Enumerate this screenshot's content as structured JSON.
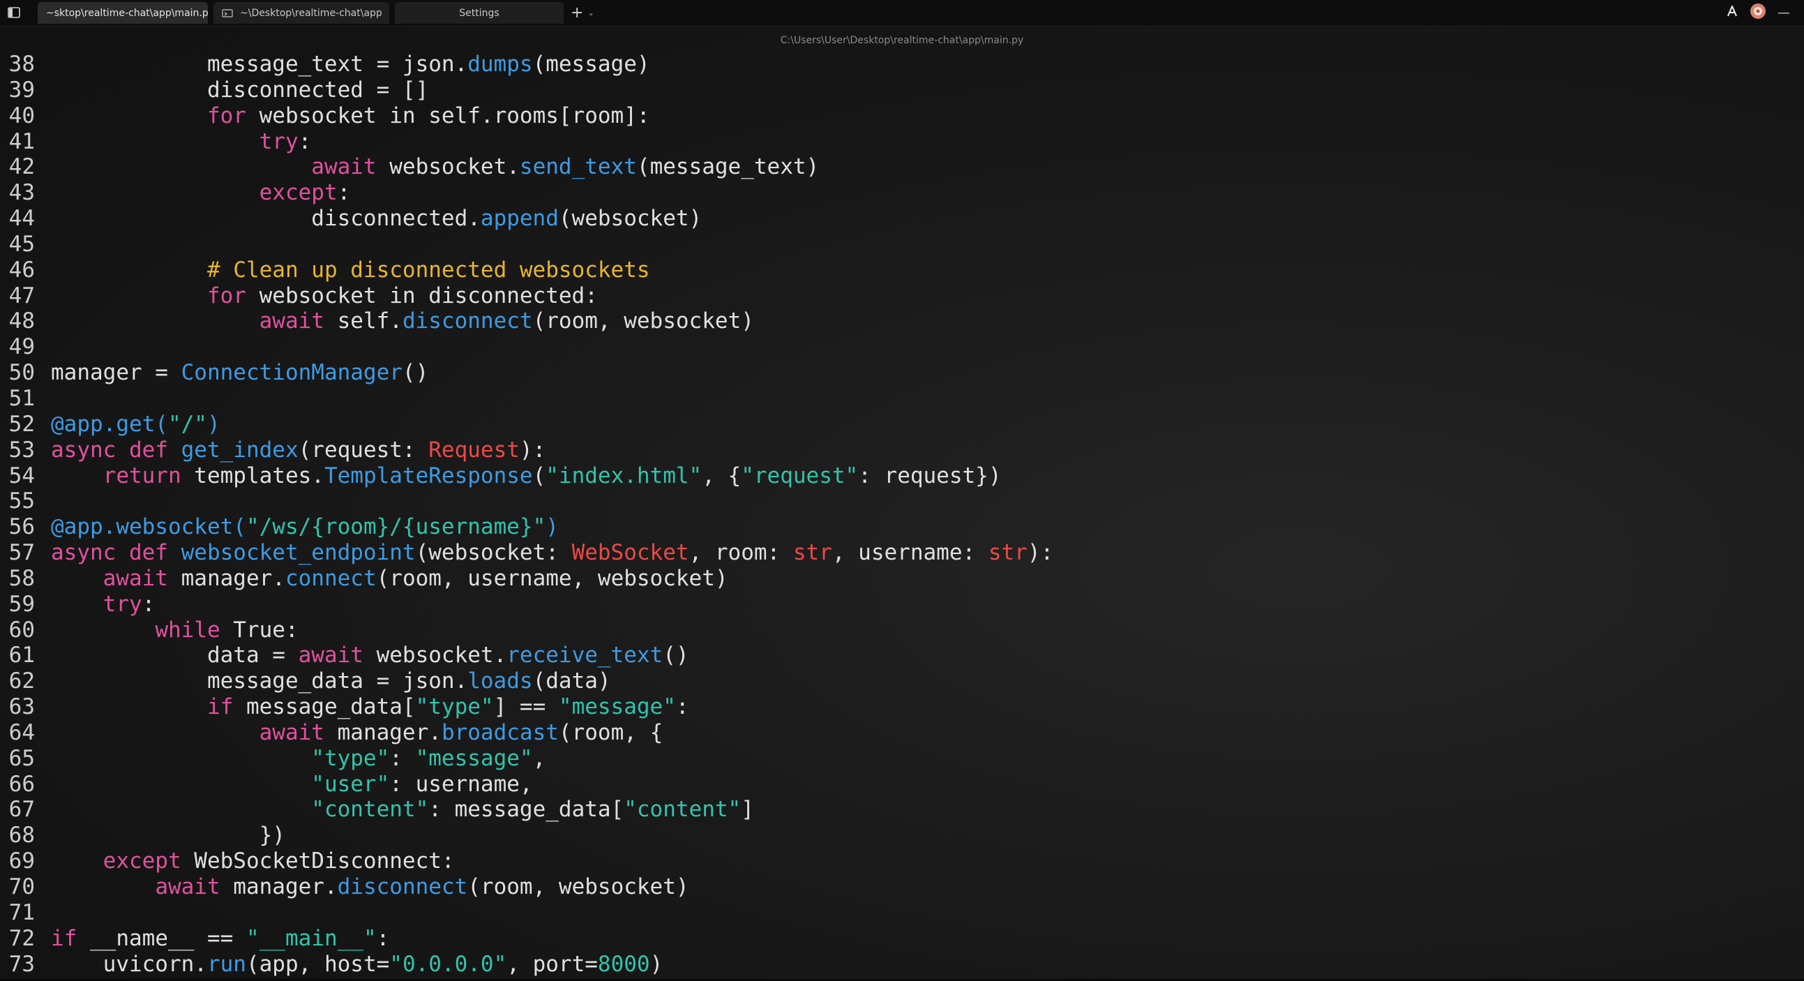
{
  "tabs": [
    {
      "label": "~sktop\\realtime-chat\\app\\main.py",
      "active": true
    },
    {
      "label": "~\\Desktop\\realtime-chat\\app",
      "active": false
    },
    {
      "label": "Settings",
      "active": false
    }
  ],
  "new_tab_symbol": "+",
  "dropdown_symbol": "⌄",
  "window_minimize_symbol": "—",
  "title_path": "C:\\Users\\User\\Desktop\\realtime-chat\\app\\main.py",
  "icons": {
    "sidebar": "sidebar-toggle-icon",
    "tab_folder": "folder-icon",
    "user_account": "account-icon",
    "profile_badge": "profile-badge-icon"
  },
  "syntax_colors": {
    "keyword": "#e0519e",
    "function": "#3e9be3",
    "string": "#33c3ac",
    "comment": "#e8b52f",
    "type": "#ea4a47",
    "plain": "#e0e0e0"
  },
  "editor": {
    "lines": [
      {
        "no": "38",
        "tokens": [
          [
            "p",
            "            message_text = json."
          ],
          [
            "fn",
            "dumps"
          ],
          [
            "p",
            "(message)"
          ]
        ]
      },
      {
        "no": "39",
        "tokens": [
          [
            "p",
            "            disconnected = []"
          ]
        ]
      },
      {
        "no": "40",
        "tokens": [
          [
            "p",
            "            "
          ],
          [
            "kw",
            "for"
          ],
          [
            "p",
            " websocket in self.rooms[room]:"
          ]
        ]
      },
      {
        "no": "41",
        "tokens": [
          [
            "p",
            "                "
          ],
          [
            "kw",
            "try"
          ],
          [
            "p",
            ":"
          ]
        ]
      },
      {
        "no": "42",
        "tokens": [
          [
            "p",
            "                    "
          ],
          [
            "kw",
            "await"
          ],
          [
            "p",
            " websocket."
          ],
          [
            "fn",
            "send_text"
          ],
          [
            "p",
            "(message_text)"
          ]
        ]
      },
      {
        "no": "43",
        "tokens": [
          [
            "p",
            "                "
          ],
          [
            "kw",
            "except"
          ],
          [
            "p",
            ":"
          ]
        ]
      },
      {
        "no": "44",
        "tokens": [
          [
            "p",
            "                    disconnected."
          ],
          [
            "fn",
            "append"
          ],
          [
            "p",
            "(websocket)"
          ]
        ]
      },
      {
        "no": "45",
        "tokens": [
          [
            "p",
            ""
          ]
        ]
      },
      {
        "no": "46",
        "tokens": [
          [
            "p",
            "            "
          ],
          [
            "cm",
            "# Clean up disconnected websockets"
          ]
        ]
      },
      {
        "no": "47",
        "tokens": [
          [
            "p",
            "            "
          ],
          [
            "kw",
            "for"
          ],
          [
            "p",
            " websocket in disconnected:"
          ]
        ]
      },
      {
        "no": "48",
        "tokens": [
          [
            "p",
            "                "
          ],
          [
            "kw",
            "await"
          ],
          [
            "p",
            " self."
          ],
          [
            "fn",
            "disconnect"
          ],
          [
            "p",
            "(room, websocket)"
          ]
        ]
      },
      {
        "no": "49",
        "tokens": [
          [
            "p",
            ""
          ]
        ]
      },
      {
        "no": "50",
        "tokens": [
          [
            "p",
            "manager = "
          ],
          [
            "fn",
            "ConnectionManager"
          ],
          [
            "p",
            "()"
          ]
        ]
      },
      {
        "no": "51",
        "tokens": [
          [
            "p",
            ""
          ]
        ]
      },
      {
        "no": "52",
        "tokens": [
          [
            "fn",
            "@app.get("
          ],
          [
            "str",
            "\"/\""
          ],
          [
            "fn",
            ")"
          ]
        ]
      },
      {
        "no": "53",
        "tokens": [
          [
            "kw",
            "async def "
          ],
          [
            "fn",
            "get_index"
          ],
          [
            "p",
            "(request: "
          ],
          [
            "ty",
            "Request"
          ],
          [
            "p",
            "):"
          ]
        ]
      },
      {
        "no": "54",
        "tokens": [
          [
            "p",
            "    "
          ],
          [
            "kw",
            "return"
          ],
          [
            "p",
            " templates."
          ],
          [
            "fn",
            "TemplateResponse"
          ],
          [
            "p",
            "("
          ],
          [
            "str",
            "\"index.html\""
          ],
          [
            "p",
            ", {"
          ],
          [
            "str",
            "\"request\""
          ],
          [
            "p",
            ": request})"
          ]
        ]
      },
      {
        "no": "55",
        "tokens": [
          [
            "p",
            ""
          ]
        ]
      },
      {
        "no": "56",
        "tokens": [
          [
            "fn",
            "@app.websocket("
          ],
          [
            "str",
            "\"/ws/{room}/{username}\""
          ],
          [
            "fn",
            ")"
          ]
        ]
      },
      {
        "no": "57",
        "tokens": [
          [
            "kw",
            "async def "
          ],
          [
            "fn",
            "websocket_endpoint"
          ],
          [
            "p",
            "(websocket: "
          ],
          [
            "ty",
            "WebSocket"
          ],
          [
            "p",
            ", room: "
          ],
          [
            "ty",
            "str"
          ],
          [
            "p",
            ", username: "
          ],
          [
            "ty",
            "str"
          ],
          [
            "p",
            "):"
          ]
        ]
      },
      {
        "no": "58",
        "tokens": [
          [
            "p",
            "    "
          ],
          [
            "kw",
            "await"
          ],
          [
            "p",
            " manager."
          ],
          [
            "fn",
            "connect"
          ],
          [
            "p",
            "(room, username, websocket)"
          ]
        ]
      },
      {
        "no": "59",
        "tokens": [
          [
            "p",
            "    "
          ],
          [
            "kw",
            "try"
          ],
          [
            "p",
            ":"
          ]
        ]
      },
      {
        "no": "60",
        "tokens": [
          [
            "p",
            "        "
          ],
          [
            "kw",
            "while"
          ],
          [
            "p",
            " True:"
          ]
        ]
      },
      {
        "no": "61",
        "tokens": [
          [
            "p",
            "            data = "
          ],
          [
            "kw",
            "await"
          ],
          [
            "p",
            " websocket."
          ],
          [
            "fn",
            "receive_text"
          ],
          [
            "p",
            "()"
          ]
        ]
      },
      {
        "no": "62",
        "tokens": [
          [
            "p",
            "            message_data = json."
          ],
          [
            "fn",
            "loads"
          ],
          [
            "p",
            "(data)"
          ]
        ]
      },
      {
        "no": "63",
        "tokens": [
          [
            "p",
            "            "
          ],
          [
            "kw",
            "if"
          ],
          [
            "p",
            " message_data["
          ],
          [
            "str",
            "\"type\""
          ],
          [
            "p",
            "] == "
          ],
          [
            "str",
            "\"message\""
          ],
          [
            "p",
            ":"
          ]
        ]
      },
      {
        "no": "64",
        "tokens": [
          [
            "p",
            "                "
          ],
          [
            "kw",
            "await"
          ],
          [
            "p",
            " manager."
          ],
          [
            "fn",
            "broadcast"
          ],
          [
            "p",
            "(room, {"
          ]
        ]
      },
      {
        "no": "65",
        "tokens": [
          [
            "p",
            "                    "
          ],
          [
            "str",
            "\"type\""
          ],
          [
            "p",
            ": "
          ],
          [
            "str",
            "\"message\""
          ],
          [
            "p",
            ","
          ]
        ]
      },
      {
        "no": "66",
        "tokens": [
          [
            "p",
            "                    "
          ],
          [
            "str",
            "\"user\""
          ],
          [
            "p",
            ": username,"
          ]
        ]
      },
      {
        "no": "67",
        "tokens": [
          [
            "p",
            "                    "
          ],
          [
            "str",
            "\"content\""
          ],
          [
            "p",
            ": message_data["
          ],
          [
            "str",
            "\"content\""
          ],
          [
            "p",
            "]"
          ]
        ]
      },
      {
        "no": "68",
        "tokens": [
          [
            "p",
            "                })"
          ]
        ]
      },
      {
        "no": "69",
        "tokens": [
          [
            "p",
            "    "
          ],
          [
            "kw",
            "except"
          ],
          [
            "p",
            " WebSocketDisconnect:"
          ]
        ]
      },
      {
        "no": "70",
        "tokens": [
          [
            "p",
            "        "
          ],
          [
            "kw",
            "await"
          ],
          [
            "p",
            " manager."
          ],
          [
            "fn",
            "disconnect"
          ],
          [
            "p",
            "(room, websocket)"
          ]
        ]
      },
      {
        "no": "71",
        "tokens": [
          [
            "p",
            ""
          ]
        ]
      },
      {
        "no": "72",
        "tokens": [
          [
            "kw",
            "if"
          ],
          [
            "p",
            " __name__ == "
          ],
          [
            "str",
            "\"__main__\""
          ],
          [
            "p",
            ":"
          ]
        ]
      },
      {
        "no": "73",
        "tokens": [
          [
            "p",
            "    uvicorn."
          ],
          [
            "fn",
            "run"
          ],
          [
            "p",
            "(app, host="
          ],
          [
            "str",
            "\"0.0.0.0\""
          ],
          [
            "p",
            ", port="
          ],
          [
            "num",
            "8000"
          ],
          [
            "p",
            ")"
          ]
        ]
      }
    ]
  }
}
